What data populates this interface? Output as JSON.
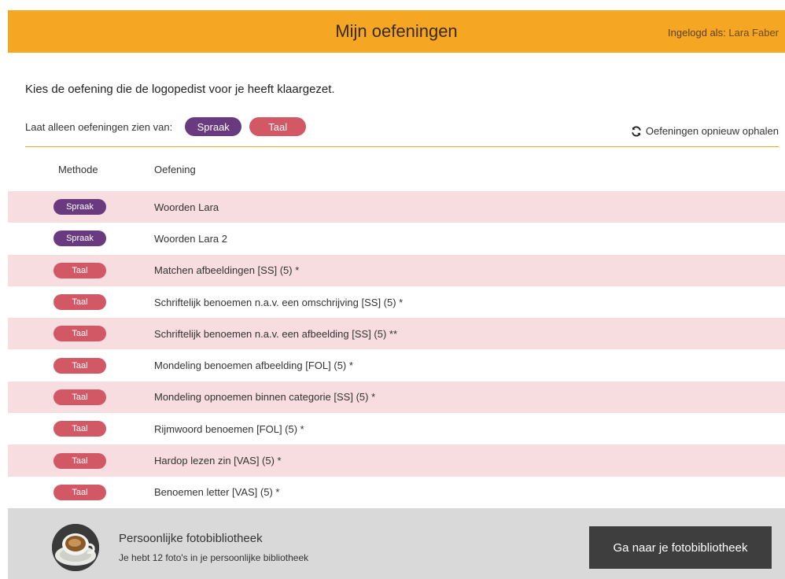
{
  "header": {
    "title": "Mijn oefeningen",
    "login_prefix": "Ingelogd als:",
    "user_name": "Lara Faber",
    "background": "#f5a623"
  },
  "intro": "Kies de oefening die de logopedist voor je heeft klaargezet.",
  "filter": {
    "label": "Laat alleen oefeningen zien van:",
    "options": [
      "Spraak",
      "Taal"
    ],
    "refresh_label": "Oefeningen opnieuw ophalen",
    "refresh_icon": "refresh-icon"
  },
  "table": {
    "columns": [
      "Methode",
      "Oefening"
    ],
    "rows": [
      {
        "method": "Spraak",
        "name": "Woorden Lara"
      },
      {
        "method": "Spraak",
        "name": "Woorden Lara 2"
      },
      {
        "method": "Taal",
        "name": "Matchen afbeeldingen [SS] (5) *"
      },
      {
        "method": "Taal",
        "name": "Schriftelijk benoemen n.a.v. een omschrijving [SS] (5) *"
      },
      {
        "method": "Taal",
        "name": "Schriftelijk benoemen n.a.v. een afbeelding [SS] (5) **"
      },
      {
        "method": "Taal",
        "name": "Mondeling benoemen afbeelding [FOL] (5) *"
      },
      {
        "method": "Taal",
        "name": "Mondeling opnoemen binnen categorie [SS] (5) *"
      },
      {
        "method": "Taal",
        "name": "Rijmwoord benoemen [FOL] (5) *"
      },
      {
        "method": "Taal",
        "name": "Hardop lezen zin [VAS] (5) *"
      },
      {
        "method": "Taal",
        "name": "Benoemen letter [VAS] (5) *"
      }
    ]
  },
  "footer": {
    "title": "Persoonlijke fotobibliotheek",
    "subtitle": "Je hebt 12 foto's in je persoonlijke bibliotheek",
    "button_label": "Ga naar je fotobibliotheek"
  },
  "colors": {
    "spraak": "#6a3a80",
    "taal": "#d35866",
    "row_alt": "#f7dce0"
  }
}
